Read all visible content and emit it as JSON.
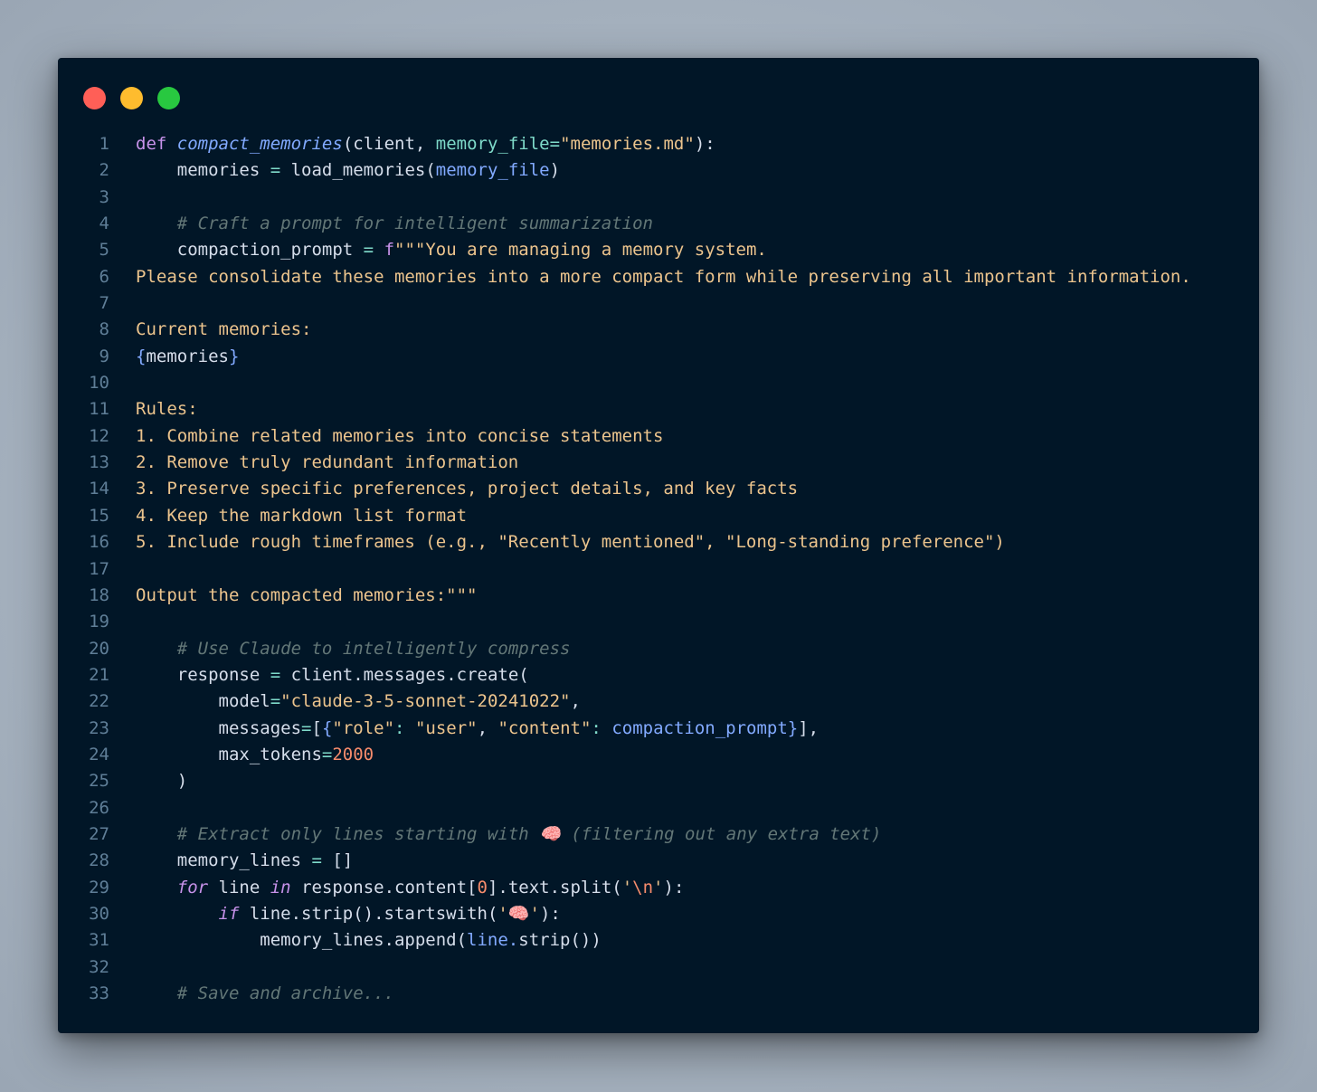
{
  "window": {
    "controls": [
      {
        "name": "close",
        "color": "#ff5f57"
      },
      {
        "name": "minimize",
        "color": "#febc2e"
      },
      {
        "name": "zoom",
        "color": "#28c840"
      }
    ]
  },
  "colors": {
    "editor_background": "#011627",
    "line_numbers": "#5f7e97",
    "keyword": "#c792ea",
    "function": "#82aaff",
    "string": "#ecc48d",
    "comment": "#637777",
    "number": "#f78c6c",
    "parameter": "#7fdbca",
    "plain": "#d6deeb"
  },
  "code": {
    "language": "python",
    "lines": [
      {
        "n": "1",
        "tokens": [
          [
            "kw",
            "def"
          ],
          [
            "pl",
            " "
          ],
          [
            "fn",
            "compact_memories"
          ],
          [
            "pl",
            "("
          ],
          [
            "pl",
            "client"
          ],
          [
            "pl",
            ", "
          ],
          [
            "pm",
            "memory_file"
          ],
          [
            "op",
            "="
          ],
          [
            "st",
            "\"memories.md\""
          ],
          [
            "pl",
            "):"
          ]
        ]
      },
      {
        "n": "2",
        "tokens": [
          [
            "pl",
            "    memories "
          ],
          [
            "op",
            "="
          ],
          [
            "pl",
            " load_memories("
          ],
          [
            "bl",
            "memory_file"
          ],
          [
            "pl",
            ")"
          ]
        ]
      },
      {
        "n": "3",
        "tokens": []
      },
      {
        "n": "4",
        "tokens": [
          [
            "pl",
            "    "
          ],
          [
            "cm",
            "# Craft a prompt for intelligent summarization"
          ]
        ]
      },
      {
        "n": "5",
        "tokens": [
          [
            "pl",
            "    compaction_prompt "
          ],
          [
            "op",
            "="
          ],
          [
            "pl",
            " "
          ],
          [
            "kw",
            "f"
          ],
          [
            "st",
            "\"\"\"You are managing a memory system."
          ]
        ]
      },
      {
        "n": "6",
        "tokens": [
          [
            "st",
            "Please consolidate these memories into a more compact form while preserving all important information."
          ]
        ]
      },
      {
        "n": "7",
        "tokens": []
      },
      {
        "n": "8",
        "tokens": [
          [
            "st",
            "Current memories:"
          ]
        ]
      },
      {
        "n": "9",
        "tokens": [
          [
            "bl",
            "{"
          ],
          [
            "pl",
            "memories"
          ],
          [
            "bl",
            "}"
          ]
        ]
      },
      {
        "n": "10",
        "tokens": []
      },
      {
        "n": "11",
        "tokens": [
          [
            "st",
            "Rules:"
          ]
        ]
      },
      {
        "n": "12",
        "tokens": [
          [
            "st",
            "1. Combine related memories into concise statements"
          ]
        ]
      },
      {
        "n": "13",
        "tokens": [
          [
            "st",
            "2. Remove truly redundant information"
          ]
        ]
      },
      {
        "n": "14",
        "tokens": [
          [
            "st",
            "3. Preserve specific preferences, project details, and key facts"
          ]
        ]
      },
      {
        "n": "15",
        "tokens": [
          [
            "st",
            "4. Keep the markdown list format"
          ]
        ]
      },
      {
        "n": "16",
        "tokens": [
          [
            "st",
            "5. Include rough timeframes (e.g., \"Recently mentioned\", \"Long-standing preference\")"
          ]
        ]
      },
      {
        "n": "17",
        "tokens": []
      },
      {
        "n": "18",
        "tokens": [
          [
            "st",
            "Output the compacted memories:\"\"\""
          ]
        ]
      },
      {
        "n": "19",
        "tokens": []
      },
      {
        "n": "20",
        "tokens": [
          [
            "pl",
            "    "
          ],
          [
            "cm",
            "# Use Claude to intelligently compress"
          ]
        ]
      },
      {
        "n": "21",
        "tokens": [
          [
            "pl",
            "    response "
          ],
          [
            "op",
            "="
          ],
          [
            "pl",
            " client.messages.create("
          ]
        ]
      },
      {
        "n": "22",
        "tokens": [
          [
            "pl",
            "        model"
          ],
          [
            "op",
            "="
          ],
          [
            "st",
            "\"claude-3-5-sonnet-20241022\""
          ],
          [
            "pl",
            ","
          ]
        ]
      },
      {
        "n": "23",
        "tokens": [
          [
            "pl",
            "        messages"
          ],
          [
            "op",
            "="
          ],
          [
            "pl",
            "["
          ],
          [
            "bl",
            "{"
          ],
          [
            "st",
            "\"role\""
          ],
          [
            "op",
            ":"
          ],
          [
            "pl",
            " "
          ],
          [
            "st",
            "\"user\""
          ],
          [
            "pl",
            ", "
          ],
          [
            "st",
            "\"content\""
          ],
          [
            "op",
            ":"
          ],
          [
            "pl",
            " "
          ],
          [
            "bl",
            "compaction_prompt}"
          ],
          [
            "pl",
            "],"
          ]
        ]
      },
      {
        "n": "24",
        "tokens": [
          [
            "pl",
            "        max_tokens"
          ],
          [
            "op",
            "="
          ],
          [
            "nm",
            "2000"
          ]
        ]
      },
      {
        "n": "25",
        "tokens": [
          [
            "pl",
            "    )"
          ]
        ]
      },
      {
        "n": "26",
        "tokens": []
      },
      {
        "n": "27",
        "tokens": [
          [
            "pl",
            "    "
          ],
          [
            "cm",
            "# Extract only lines starting with 🧠 (filtering out any extra text)"
          ]
        ]
      },
      {
        "n": "28",
        "tokens": [
          [
            "pl",
            "    memory_lines "
          ],
          [
            "op",
            "="
          ],
          [
            "pl",
            " []"
          ]
        ]
      },
      {
        "n": "29",
        "tokens": [
          [
            "pl",
            "    "
          ],
          [
            "kwi",
            "for"
          ],
          [
            "pl",
            " line "
          ],
          [
            "kwi",
            "in"
          ],
          [
            "pl",
            " response.content["
          ],
          [
            "nm",
            "0"
          ],
          [
            "pl",
            "].text.split("
          ],
          [
            "st",
            "'"
          ],
          [
            "es",
            "\\n"
          ],
          [
            "st",
            "'"
          ],
          [
            "pl",
            "):"
          ]
        ]
      },
      {
        "n": "30",
        "tokens": [
          [
            "pl",
            "        "
          ],
          [
            "kwi",
            "if"
          ],
          [
            "pl",
            " line.strip().startswith("
          ],
          [
            "st",
            "'🧠'"
          ],
          [
            "pl",
            "):"
          ]
        ]
      },
      {
        "n": "31",
        "tokens": [
          [
            "pl",
            "            memory_lines.append("
          ],
          [
            "bl",
            "line."
          ],
          [
            "pl",
            "strip())"
          ]
        ]
      },
      {
        "n": "32",
        "tokens": []
      },
      {
        "n": "33",
        "tokens": [
          [
            "pl",
            "    "
          ],
          [
            "cm",
            "# Save and archive..."
          ]
        ]
      }
    ]
  }
}
